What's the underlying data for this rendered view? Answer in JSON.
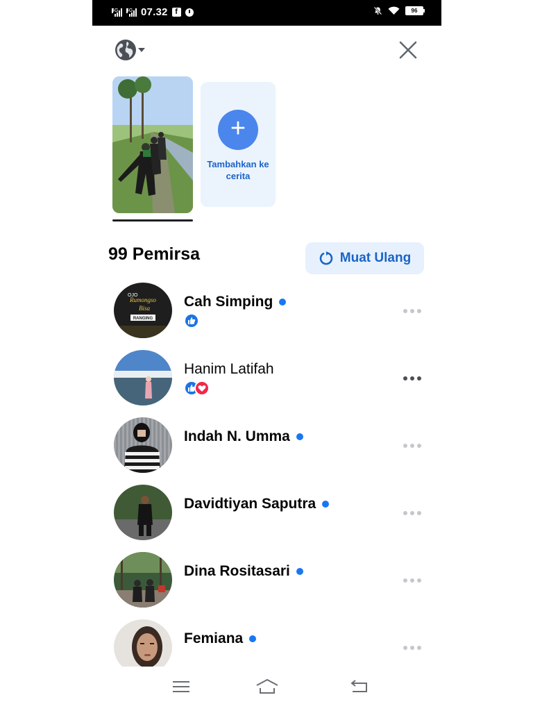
{
  "status_bar": {
    "net1": "4G",
    "net2": "4G",
    "time": "07.32",
    "fb_badge": "f",
    "battery": "96"
  },
  "top_bar": {
    "audience_icon": "globe-icon",
    "close_icon": "close-icon"
  },
  "stories": {
    "add_label": "Tambahkan ke cerita"
  },
  "viewers": {
    "count_label": "99 Pemirsa",
    "reload_label": "Muat Ulang",
    "list": [
      {
        "name": "Cah Simping",
        "online": true,
        "bold": true,
        "reactions": [
          "like"
        ]
      },
      {
        "name": "Hanim Latifah",
        "online": false,
        "bold": false,
        "reactions": [
          "like",
          "love"
        ]
      },
      {
        "name": "Indah N. Umma",
        "online": true,
        "bold": true,
        "reactions": []
      },
      {
        "name": "Davidtiyan Saputra",
        "online": true,
        "bold": true,
        "reactions": []
      },
      {
        "name": "Dina Rositasari",
        "online": true,
        "bold": true,
        "reactions": []
      },
      {
        "name": "Femiana",
        "online": true,
        "bold": true,
        "reactions": []
      }
    ],
    "avatar_logo_lines": [
      "OJO",
      "Rumongso",
      "Bisa",
      "RANGING"
    ]
  },
  "colors": {
    "accent": "#1877f2",
    "button_blue": "#4a86ec",
    "like": "#1b74e4",
    "love": "#f0284a"
  }
}
